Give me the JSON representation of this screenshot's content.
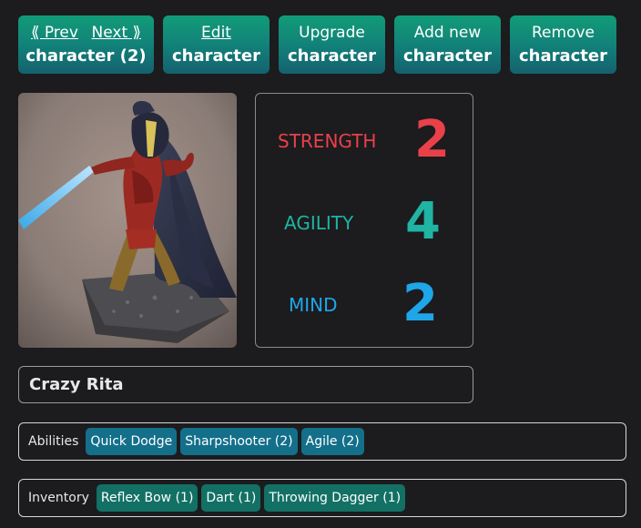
{
  "toolbar": {
    "prev_label": "⟪ Prev",
    "next_label": "Next ⟫",
    "nav_bottom": "character (2)",
    "edit_top": "Edit",
    "edit_bottom": "character",
    "upgrade_top": "Upgrade",
    "upgrade_bottom": "character",
    "add_top": "Add new",
    "add_bottom": "character",
    "remove_top": "Remove",
    "remove_bottom": "character"
  },
  "stats": [
    {
      "label": "STRENGTH",
      "value": "2",
      "color": "#e8414a"
    },
    {
      "label": "AGILITY",
      "value": "4",
      "color": "#1fb4a3"
    },
    {
      "label": "MIND",
      "value": "2",
      "color": "#1ea6e8"
    }
  ],
  "character": {
    "name": "Crazy Rita"
  },
  "abilities": {
    "label": "Abilities",
    "items": [
      "Quick Dodge",
      "Sharpshooter (2)",
      "Agile (2)"
    ]
  },
  "inventory": {
    "label": "Inventory",
    "items": [
      "Reflex Bow (1)",
      "Dart (1)",
      "Throwing Dagger (1)"
    ]
  }
}
